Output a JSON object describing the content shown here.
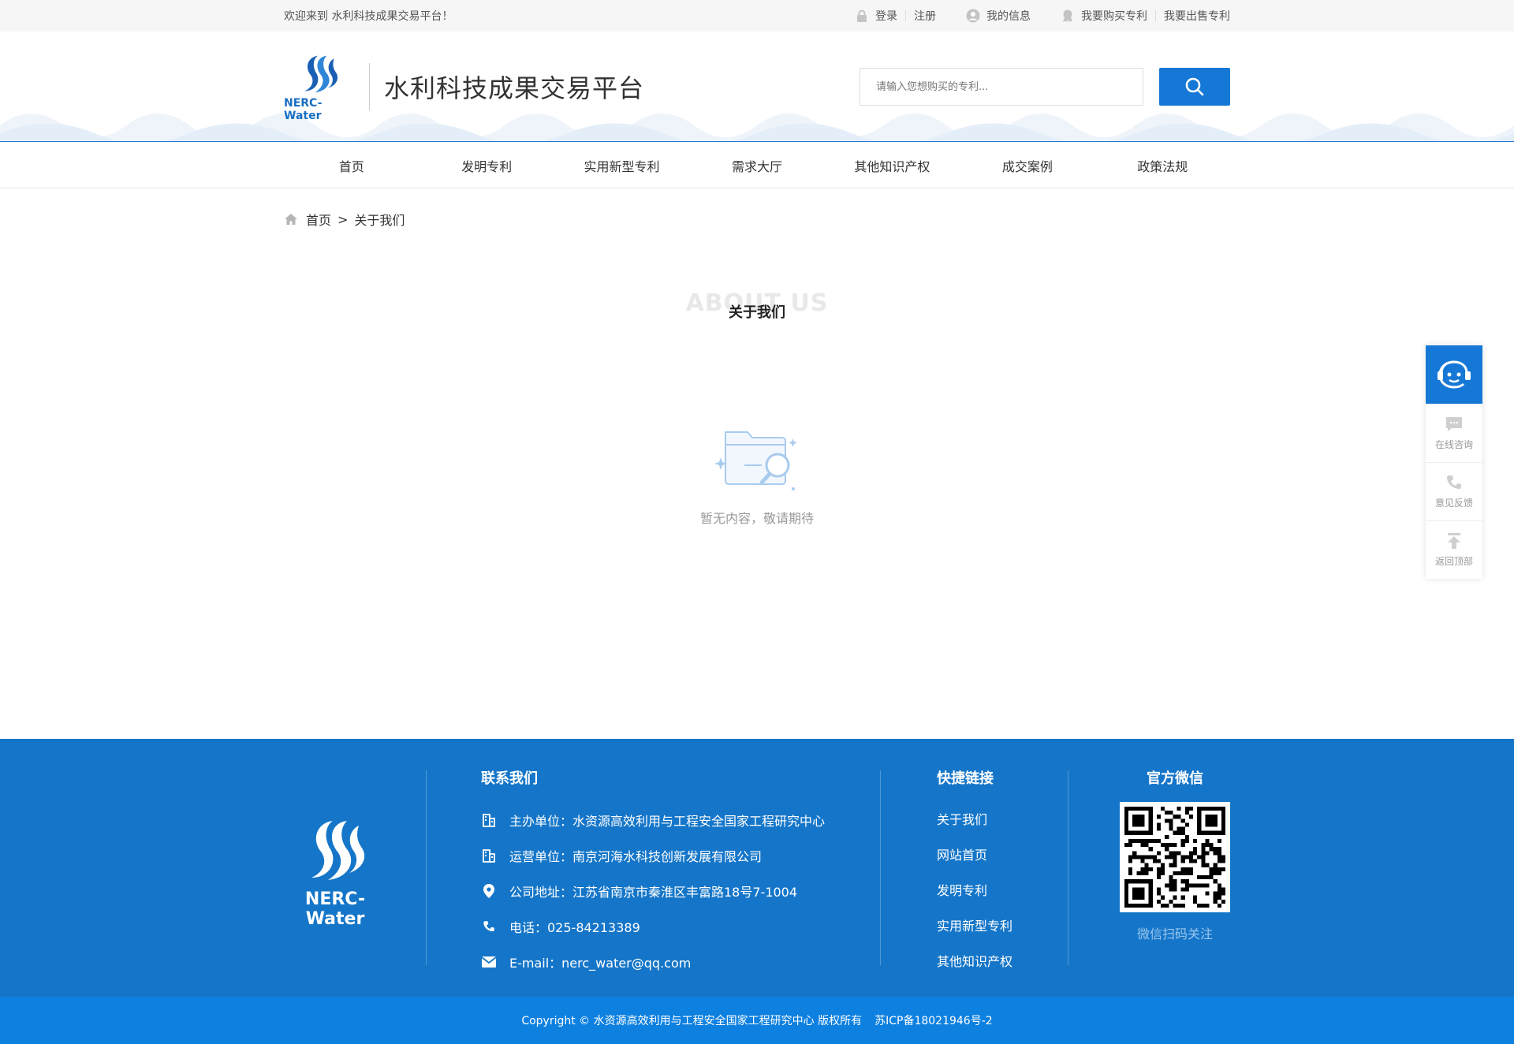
{
  "topbar": {
    "welcome": "欢迎来到  水利科技成果交易平台！",
    "login": "登录",
    "register": "注册",
    "my_info": "我的信息",
    "buy_patent": "我要购买专利",
    "sell_patent": "我要出售专利"
  },
  "header": {
    "logo_text": "NERC-Water",
    "site_title": "水利科技成果交易平台",
    "search_placeholder": "请输入您想购买的专利..."
  },
  "nav": {
    "items": [
      "首页",
      "发明专利",
      "实用新型专利",
      "需求大厅",
      "其他知识产权",
      "成交案例",
      "政策法规"
    ]
  },
  "breadcrumb": {
    "home": "首页",
    "separator": ">",
    "current": "关于我们"
  },
  "about": {
    "title_en": "ABOUT US",
    "title_zh": "关于我们"
  },
  "empty_state": {
    "text": "暂无内容，敬请期待"
  },
  "side_float": {
    "online": "在线咨询",
    "feedback": "意见反馈",
    "top": "返回顶部"
  },
  "footer": {
    "logo_text": "NERC-Water",
    "contact_title": "联系我们",
    "contact": [
      "主办单位：水资源高效利用与工程安全国家工程研究中心",
      "运营单位：南京河海水科技创新发展有限公司",
      "公司地址：江苏省南京市秦淮区丰富路18号7-1004",
      "电话：025-84213389",
      "E-mail：nerc_water@qq.com"
    ],
    "links_title": "快捷链接",
    "links": [
      "关于我们",
      "网站首页",
      "发明专利",
      "实用新型专利",
      "其他知识产权"
    ],
    "wechat_title": "官方微信",
    "wechat_caption": "微信扫码关注"
  },
  "copyright": {
    "text": "Copyright © 水资源高效利用与工程安全国家工程研究中心 版权所有",
    "icp": "苏ICP备18021946号-2"
  },
  "colors": {
    "primary": "#1578d6",
    "footer_bg": "#1576c9",
    "copyright_bg": "#0d80e0"
  }
}
